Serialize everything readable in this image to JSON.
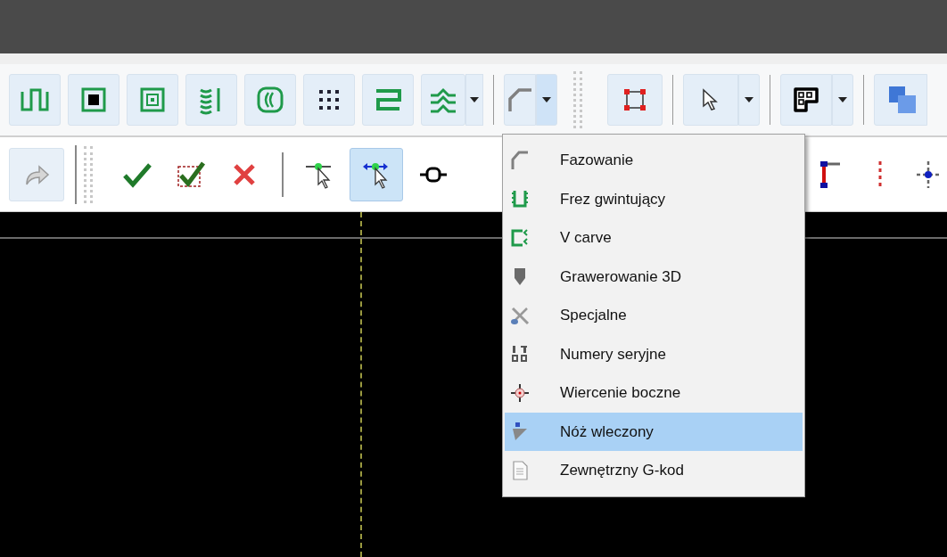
{
  "toolbar_2": {
    "tools": [
      {
        "selected": false
      },
      {
        "selected": true
      },
      {
        "selected": false
      }
    ]
  },
  "dropdown_menu": {
    "items": [
      {
        "label": "Fazowanie",
        "selected": false
      },
      {
        "label": "Frez gwintujący",
        "selected": false
      },
      {
        "label": "V carve",
        "selected": false
      },
      {
        "label": "Grawerowanie 3D",
        "selected": false
      },
      {
        "label": "Specjalne",
        "selected": false
      },
      {
        "label": "Numery seryjne",
        "selected": false
      },
      {
        "label": "Wiercenie boczne",
        "selected": false
      },
      {
        "label": "Nóż wleczony",
        "selected": true
      },
      {
        "label": "Zewnętrzny G-kod",
        "selected": false
      }
    ]
  }
}
